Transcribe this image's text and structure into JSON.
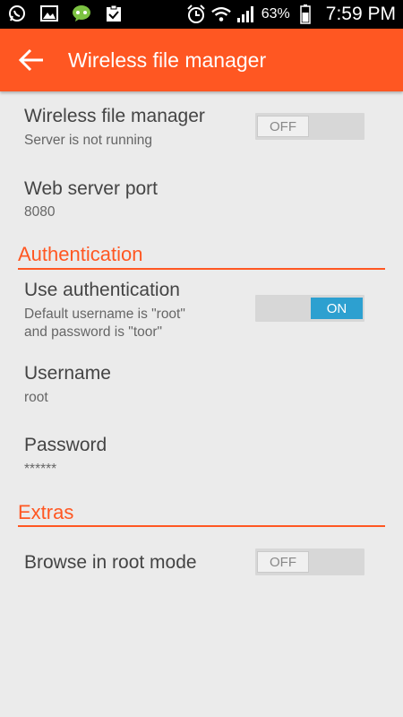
{
  "status_bar": {
    "battery": "63%",
    "time": "7:59 PM",
    "icons": [
      "whatsapp-icon",
      "gallery-icon",
      "chat-app-icon",
      "clipboard-check-icon",
      "alarm-icon",
      "wifi-icon",
      "signal-icon",
      "battery-icon"
    ]
  },
  "app_bar": {
    "title": "Wireless file manager",
    "back_icon": "arrow-left-icon"
  },
  "prefs": {
    "server": {
      "title": "Wireless file manager",
      "summary": "Server is not running",
      "switch": "OFF"
    },
    "port": {
      "title": "Web server port",
      "summary": "8080"
    },
    "auth_section": "Authentication",
    "use_auth": {
      "title": "Use authentication",
      "summary": "Default username is \"root\"\nand password is \"toor\"",
      "switch": "ON"
    },
    "username": {
      "title": "Username",
      "summary": "root"
    },
    "password": {
      "title": "Password",
      "summary": "******"
    },
    "extras_section": "Extras",
    "root_mode": {
      "title": "Browse in root mode",
      "switch": "OFF"
    }
  },
  "colors": {
    "accent": "#ff5722",
    "switch_on": "#2da0d0",
    "background": "#ebebeb"
  }
}
